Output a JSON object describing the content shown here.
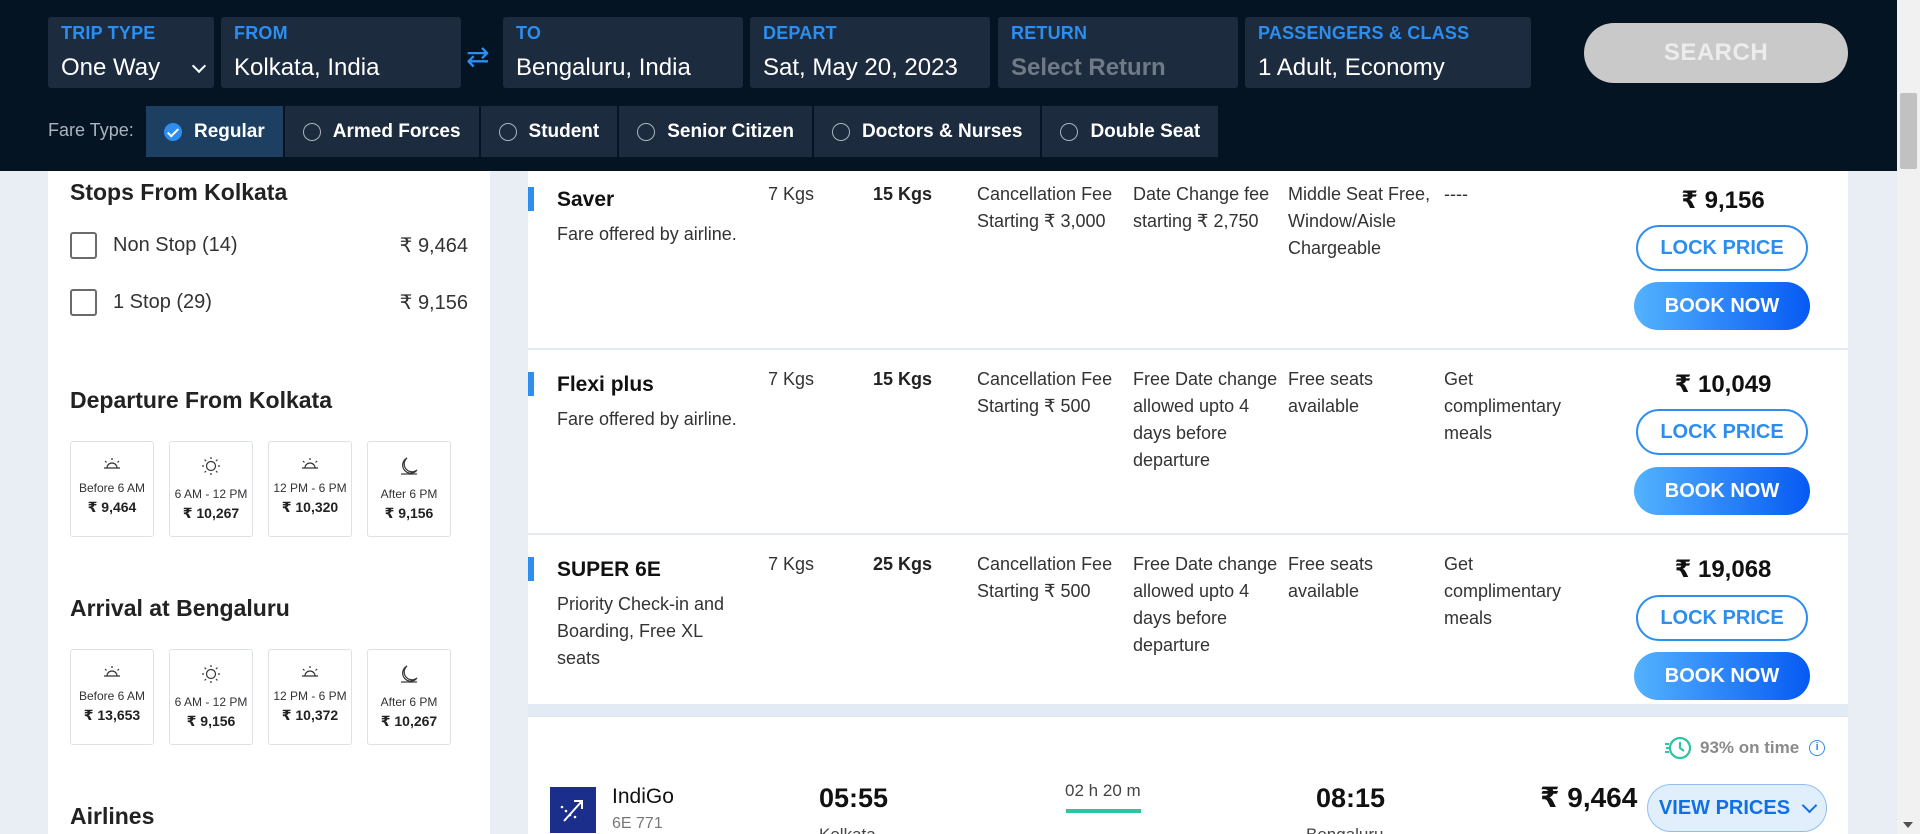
{
  "search": {
    "trip_type": {
      "label": "TRIP TYPE",
      "value": "One Way"
    },
    "from": {
      "label": "FROM",
      "value": "Kolkata, India"
    },
    "to": {
      "label": "TO",
      "value": "Bengaluru, India"
    },
    "depart": {
      "label": "DEPART",
      "value": "Sat, May 20, 2023"
    },
    "return": {
      "label": "RETURN",
      "placeholder": "Select Return"
    },
    "passengers": {
      "label": "PASSENGERS & CLASS",
      "value": "1 Adult, Economy"
    },
    "swap_glyph": "⇄",
    "search_label": "SEARCH"
  },
  "fare_type": {
    "label": "Fare Type:",
    "options": [
      "Regular",
      "Armed Forces",
      "Student",
      "Senior Citizen",
      "Doctors & Nurses",
      "Double Seat"
    ],
    "selected": "Regular"
  },
  "filters": {
    "stops": {
      "title": "Stops From Kolkata",
      "items": [
        {
          "label": "Non Stop (14)",
          "price": "₹ 9,464"
        },
        {
          "label": "1 Stop (29)",
          "price": "₹ 9,156"
        }
      ]
    },
    "departure": {
      "title": "Departure From Kolkata",
      "slots": [
        {
          "icon": "sunrise-icon",
          "label": "Before 6 AM",
          "price": "₹ 9,464"
        },
        {
          "icon": "sun-icon",
          "label": "6 AM - 12 PM",
          "price": "₹ 10,267"
        },
        {
          "icon": "sunset-icon",
          "label": "12 PM - 6 PM",
          "price": "₹ 10,320"
        },
        {
          "icon": "moon-icon",
          "label": "After 6 PM",
          "price": "₹ 9,156"
        }
      ]
    },
    "arrival": {
      "title": "Arrival at Bengaluru",
      "slots": [
        {
          "icon": "sunrise-icon",
          "label": "Before 6 AM",
          "price": "₹ 13,653"
        },
        {
          "icon": "sun-icon",
          "label": "6 AM - 12 PM",
          "price": "₹ 9,156"
        },
        {
          "icon": "sunset-icon",
          "label": "12 PM - 6 PM",
          "price": "₹ 10,372"
        },
        {
          "icon": "moon-icon",
          "label": "After 6 PM",
          "price": "₹ 10,267"
        }
      ]
    },
    "airlines_title": "Airlines"
  },
  "fares": [
    {
      "name": "Saver",
      "desc": "Fare offered by airline.",
      "cabin": "7 Kgs",
      "checkin": "15 Kgs",
      "cancellation": "Cancellation Fee Starting ₹ 3,000",
      "date_change": "Date Change fee starting ₹ 2,750",
      "seats": "Middle Seat Free, Window/Aisle Chargeable",
      "meals": "----",
      "price": "₹ 9,156"
    },
    {
      "name": "Flexi plus",
      "desc": "Fare offered by airline.",
      "cabin": "7 Kgs",
      "checkin": "15 Kgs",
      "cancellation": "Cancellation Fee Starting ₹ 500",
      "date_change": "Free Date change allowed upto 4 days before departure",
      "seats": "Free seats available",
      "meals": "Get complimentary meals",
      "price": "₹ 10,049"
    },
    {
      "name": "SUPER 6E",
      "desc": "Priority Check-in and Boarding, Free XL seats",
      "cabin": "7 Kgs",
      "checkin": "25 Kgs",
      "cancellation": "Cancellation Fee Starting ₹ 500",
      "date_change": "Free Date change allowed upto 4 days before departure",
      "seats": "Free seats available",
      "meals": "Get complimentary meals",
      "price": "₹ 19,068"
    }
  ],
  "fare_actions": {
    "lock_label": "LOCK PRICE",
    "book_label": "BOOK NOW"
  },
  "flight": {
    "on_time": "93% on time",
    "airline": "IndiGo",
    "flight_no": "6E 771",
    "dep_time": "05:55",
    "dep_city": "Kolkata",
    "duration_h": "02",
    "duration_h_unit": "h",
    "duration_m": "20",
    "duration_m_unit": "m",
    "arr_time": "08:15",
    "arr_city": "Bengaluru",
    "price": "₹ 9,464",
    "view_label": "VIEW PRICES"
  },
  "colors": {
    "header_bg": "#051423",
    "accent": "#2d8ef0",
    "book_gradient_start": "#53b2fe",
    "book_gradient_end": "#065af3",
    "on_time_green": "#2ec4a0"
  }
}
